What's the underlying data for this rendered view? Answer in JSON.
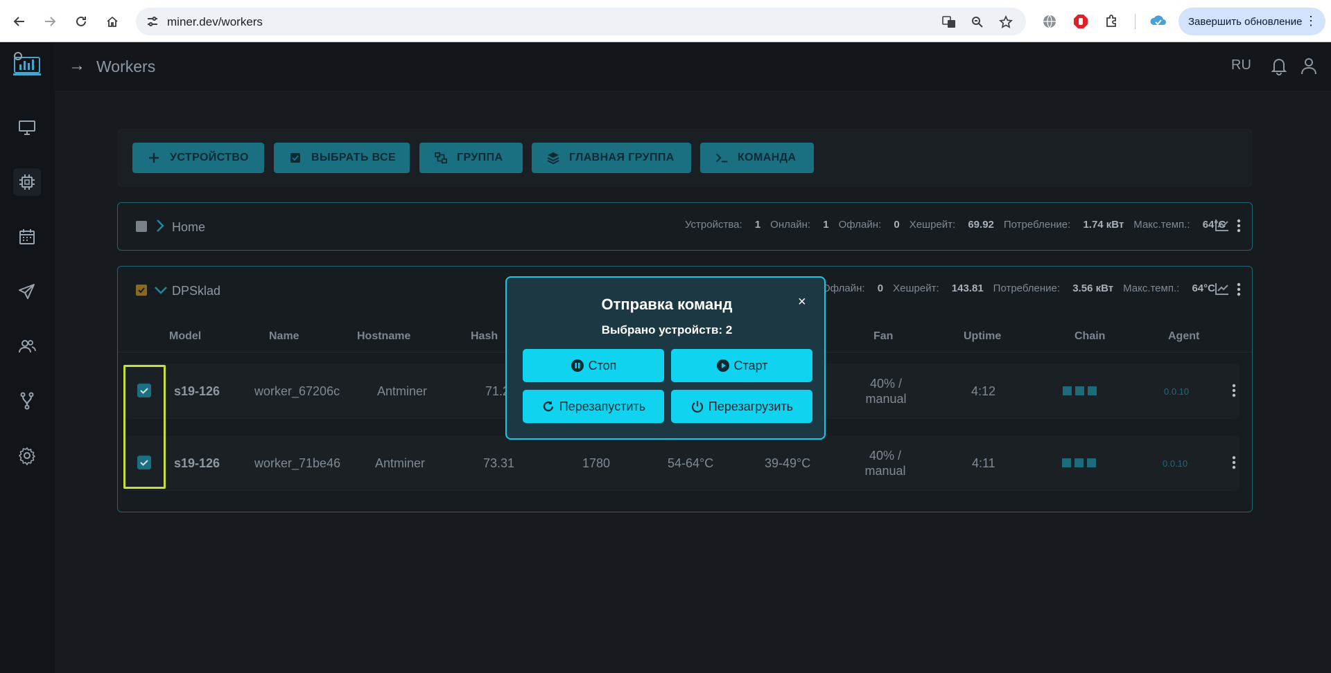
{
  "browser": {
    "url": "miner.dev/workers",
    "update_label": "Завершить обновление"
  },
  "header": {
    "title": "Workers",
    "lang": "RU"
  },
  "toolbar": {
    "add_device": "УСТРОЙСТВО",
    "select_all": "ВЫБРАТЬ ВСЕ",
    "group": "ГРУППА",
    "main_group": "ГЛАВНАЯ ГРУППА",
    "command": "КОМАНДА"
  },
  "groups": [
    {
      "name": "Home",
      "stats": {
        "devices_label": "Устройства:",
        "devices": "1",
        "online_label": "Онлайн:",
        "online": "1",
        "offline_label": "Офлайн:",
        "offline": "0",
        "hashrate_label": "Хешрейт:",
        "hashrate": "69.92",
        "power_label": "Потребление:",
        "power": "1.74 кВт",
        "maxtemp_label": "Макс.темп.:",
        "maxtemp": "64°C"
      }
    },
    {
      "name": "DPSklad",
      "stats": {
        "offline_label": "Офлайн:",
        "offline": "0",
        "hashrate_label": "Хешрейт:",
        "hashrate": "143.81",
        "power_label": "Потребление:",
        "power": "3.56 кВт",
        "maxtemp_label": "Макс.темп.:",
        "maxtemp": "64°C"
      },
      "columns": [
        "Model",
        "Name",
        "Hostname",
        "Hash",
        "Fan",
        "Uptime",
        "Chain",
        "Agent"
      ],
      "rows": [
        {
          "model": "s19-126",
          "name": "worker_67206c",
          "hostname": "Antminer",
          "hash": "71.2",
          "fan": "40% /",
          "fan_mode": "manual",
          "uptime": "4:12",
          "agent": "0.0.10"
        },
        {
          "model": "s19-126",
          "name": "worker_71be46",
          "hostname": "Antminer",
          "hash": "73.31",
          "power": "1780",
          "temp1": "54-64°C",
          "temp2": "39-49°C",
          "fan": "40% /",
          "fan_mode": "manual",
          "uptime": "4:11",
          "agent": "0.0.10"
        }
      ]
    }
  ],
  "modal": {
    "title": "Отправка команд",
    "subtitle": "Выбрано устройств: 2",
    "stop": "Стоп",
    "start": "Старт",
    "restart": "Перезапустить",
    "reboot": "Перезагрузить",
    "close": "×"
  }
}
